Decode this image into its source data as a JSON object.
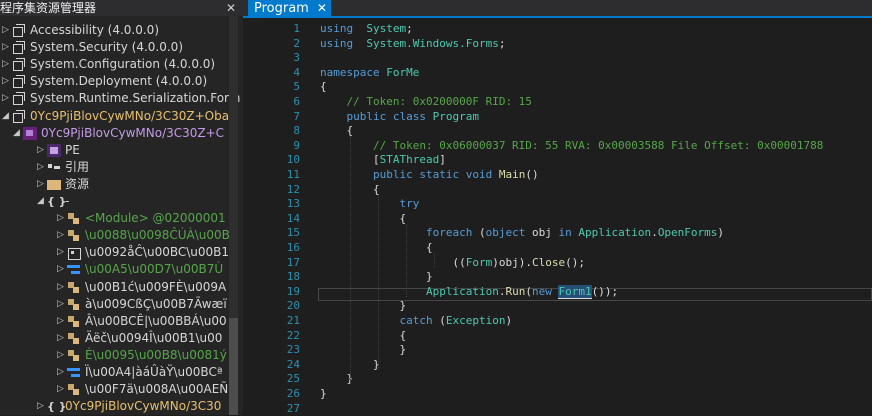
{
  "explorer": {
    "title": "程序集资源管理器",
    "close": "✕",
    "rows": [
      {
        "indent": 0,
        "expander": "▷",
        "icon": "assembly-icon",
        "label": "Accessibility (4.0.0.0)",
        "color": "grey"
      },
      {
        "indent": 0,
        "expander": "▷",
        "icon": "assembly-icon",
        "label": "System.Security (4.0.0.0)",
        "color": "grey"
      },
      {
        "indent": 0,
        "expander": "▷",
        "icon": "assembly-icon",
        "label": "System.Configuration (4.0.0.0)",
        "color": "grey"
      },
      {
        "indent": 0,
        "expander": "▷",
        "icon": "assembly-icon",
        "label": "System.Deployment (4.0.0.0)",
        "color": "grey"
      },
      {
        "indent": 0,
        "expander": "▷",
        "icon": "assembly-icon",
        "label": "System.Runtime.Serialization.Form",
        "color": "grey"
      },
      {
        "indent": 0,
        "expander": "◢",
        "icon": "assembly-icon",
        "label": "0Yc9PjiBlovCywMNo/3C30Z+Oba",
        "color": "yellow"
      },
      {
        "indent": 1,
        "expander": "◢",
        "icon": "module-icon",
        "label": "0Yc9PjiBlovCywMNo/3C30Z+C",
        "color": "purple"
      },
      {
        "indent": 2,
        "expander": "▷",
        "icon": "pe-icon",
        "label": "PE",
        "color": "grey"
      },
      {
        "indent": 2,
        "expander": "▷",
        "icon": "references-icon",
        "label": "引用",
        "color": "grey"
      },
      {
        "indent": 2,
        "expander": "▷",
        "icon": "folder-icon",
        "label": "资源",
        "color": "grey"
      },
      {
        "indent": 2,
        "expander": "◢",
        "icon": "namespace-icon",
        "label": "-",
        "color": "grey"
      },
      {
        "indent": 3,
        "expander": "▷",
        "icon": "class-icon",
        "label": "<Module> @02000001",
        "color": "green"
      },
      {
        "indent": 3,
        "expander": "▷",
        "icon": "class-icon",
        "label": "\\u0088\\u0098ĈÚÀ\\u00B",
        "color": "green"
      },
      {
        "indent": 3,
        "expander": "▷",
        "icon": "class-outline-icon",
        "label": "\\u0092åĈ\\u00BC\\u00B1",
        "color": "grey"
      },
      {
        "indent": 3,
        "expander": "▷",
        "icon": "enum-icon",
        "label": "\\u00A5\\u00D7\\u00B7Ù",
        "color": "green"
      },
      {
        "indent": 3,
        "expander": "▷",
        "icon": "class-icon",
        "label": "\\u00B1ć\\u009FÈ\\u009A",
        "color": "grey"
      },
      {
        "indent": 3,
        "expander": "▷",
        "icon": "class-icon",
        "label": "à\\u009CßÇ\\u00B7Ãwæï",
        "color": "grey"
      },
      {
        "indent": 3,
        "expander": "▷",
        "icon": "class-icon",
        "label": "Â\\u00BCÊ|\\u00BBÁ\\u00",
        "color": "grey"
      },
      {
        "indent": 3,
        "expander": "▷",
        "icon": "class-icon",
        "label": "Äëč\\u0094Î\\u00B1\\u00",
        "color": "grey"
      },
      {
        "indent": 3,
        "expander": "▷",
        "icon": "class-icon",
        "label": "É\\u0095\\u00B8\\u0081ý",
        "color": "green"
      },
      {
        "indent": 3,
        "expander": "▷",
        "icon": "enum-icon",
        "label": "Ï\\u00A4|àáÛàŸ\\u00BCª",
        "color": "grey"
      },
      {
        "indent": 3,
        "expander": "▷",
        "icon": "class-icon",
        "label": "\\u00F7ä\\u008A\\u00AEÑ",
        "color": "grey"
      },
      {
        "indent": 2,
        "expander": "▷",
        "icon": "namespace-icon",
        "label": "0Yc9PjiBlovCywMNo/3C30",
        "color": "yellow"
      }
    ]
  },
  "editor": {
    "tab_label": "Program",
    "tab_close": "✕",
    "accent": "#007acc",
    "lines": [
      [
        [
          "kw",
          "using"
        ],
        [
          "",
          "  "
        ],
        [
          "ty",
          "System"
        ],
        [
          "",
          ";"
        ]
      ],
      [
        [
          "kw",
          "using"
        ],
        [
          "",
          "  "
        ],
        [
          "ty",
          "System.Windows.Forms"
        ],
        [
          "",
          ";"
        ]
      ],
      [],
      [
        [
          "kw",
          "namespace"
        ],
        [
          "",
          " "
        ],
        [
          "ty",
          "ForMe"
        ]
      ],
      [
        [
          "",
          "{"
        ]
      ],
      [
        [
          "",
          "    "
        ],
        [
          "cm",
          "// Token: 0x0200000F RID: 15"
        ]
      ],
      [
        [
          "",
          "    "
        ],
        [
          "kw",
          "public"
        ],
        [
          "",
          " "
        ],
        [
          "kw",
          "class"
        ],
        [
          "",
          " "
        ],
        [
          "ty",
          "Program"
        ]
      ],
      [
        [
          "",
          "    {"
        ]
      ],
      [
        [
          "",
          "        "
        ],
        [
          "cm",
          "// Token: 0x06000037 RID: 55 RVA: 0x00003588 File Offset: 0x00001788"
        ]
      ],
      [
        [
          "",
          "        ["
        ],
        [
          "at",
          "STAThread"
        ],
        [
          "",
          "]"
        ]
      ],
      [
        [
          "",
          "        "
        ],
        [
          "kw",
          "public"
        ],
        [
          "",
          " "
        ],
        [
          "kw",
          "static"
        ],
        [
          "",
          " "
        ],
        [
          "kw",
          "void"
        ],
        [
          "",
          " "
        ],
        [
          "fn",
          "Main"
        ],
        [
          "",
          "()"
        ]
      ],
      [
        [
          "",
          "        {"
        ]
      ],
      [
        [
          "",
          "            "
        ],
        [
          "kw",
          "try"
        ]
      ],
      [
        [
          "",
          "            {"
        ]
      ],
      [
        [
          "",
          "                "
        ],
        [
          "kw",
          "foreach"
        ],
        [
          "",
          " ("
        ],
        [
          "kw",
          "object"
        ],
        [
          "",
          " obj "
        ],
        [
          "kw",
          "in"
        ],
        [
          "",
          " "
        ],
        [
          "ty",
          "Application"
        ],
        [
          "",
          "."
        ],
        [
          "ty",
          "OpenForms"
        ],
        [
          "",
          ")"
        ]
      ],
      [
        [
          "",
          "                {"
        ]
      ],
      [
        [
          "",
          "                    (("
        ],
        [
          "ty",
          "Form"
        ],
        [
          "",
          ")obj)."
        ],
        [
          "fn",
          "Close"
        ],
        [
          "",
          "();"
        ]
      ],
      [
        [
          "",
          "                }"
        ]
      ],
      [
        [
          "",
          "                "
        ],
        [
          "ty",
          "Application"
        ],
        [
          "",
          "."
        ],
        [
          "fn",
          "Run"
        ],
        [
          "",
          "("
        ],
        [
          "kw",
          "new"
        ],
        [
          "",
          " "
        ],
        [
          "ty",
          "Form1"
        ],
        [
          "",
          "());"
        ]
      ],
      [
        [
          "",
          "            }"
        ]
      ],
      [
        [
          "",
          "            "
        ],
        [
          "kw",
          "catch"
        ],
        [
          "",
          " ("
        ],
        [
          "ty",
          "Exception"
        ],
        [
          "",
          ")"
        ]
      ],
      [
        [
          "",
          "            {"
        ]
      ],
      [
        [
          "",
          "            }"
        ]
      ],
      [
        [
          "",
          "        }"
        ]
      ],
      [
        [
          "",
          "    }"
        ]
      ],
      [
        [
          "",
          "}"
        ]
      ],
      []
    ],
    "line_numbers": [
      "1",
      "2",
      "3",
      "4",
      "5",
      "6",
      "7",
      "8",
      "9",
      "10",
      "11",
      "12",
      "13",
      "14",
      "15",
      "16",
      "17",
      "18",
      "19",
      "20",
      "21",
      "22",
      "23",
      "24",
      "25",
      "26",
      "27"
    ]
  }
}
